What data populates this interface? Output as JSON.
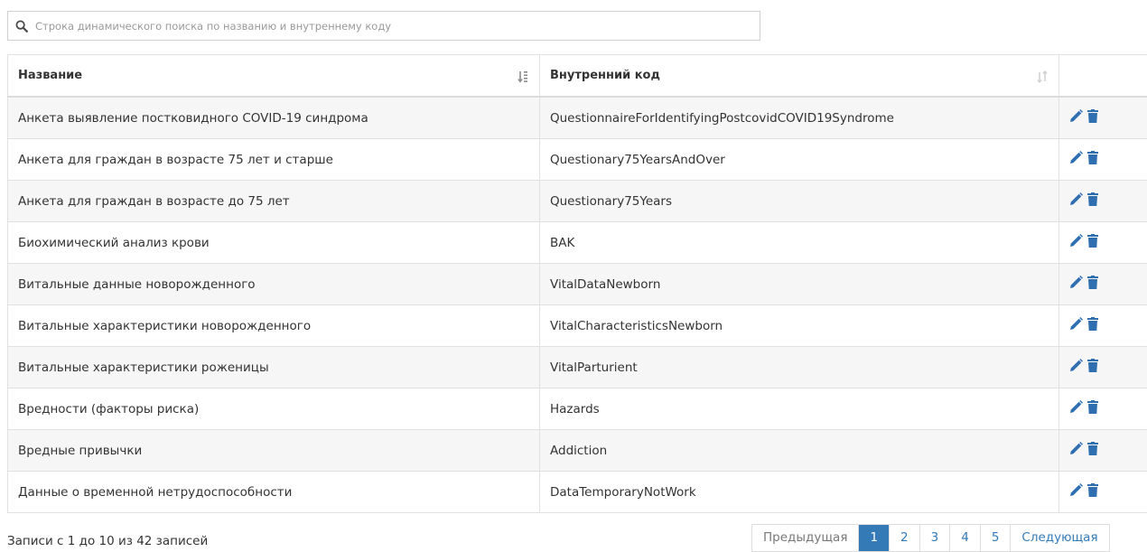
{
  "search": {
    "placeholder": "Строка динамического поиска по названию и внутреннему коду"
  },
  "table": {
    "columns": [
      "Название",
      "Внутренний код"
    ],
    "rows": [
      {
        "name": "Анкета выявление постковидного COVID-19 синдрома",
        "code": "QuestionnaireForIdentifyingPostcovidCOVID19Syndrome"
      },
      {
        "name": "Анкета для граждан в возрасте 75 лет и старше",
        "code": "Questionary75YearsAndOver"
      },
      {
        "name": "Анкета для граждан в возрасте до 75 лет",
        "code": "Questionary75Years"
      },
      {
        "name": "Биохимический анализ крови",
        "code": "BAK"
      },
      {
        "name": "Витальные данные новорожденного",
        "code": "VitalDataNewborn"
      },
      {
        "name": "Витальные характеристики новорожденного",
        "code": "VitalCharacteristicsNewborn"
      },
      {
        "name": "Витальные характеристики роженицы",
        "code": "VitalParturient"
      },
      {
        "name": "Вредности (факторы риска)",
        "code": "Hazards"
      },
      {
        "name": "Вредные привычки",
        "code": "Addiction"
      },
      {
        "name": "Данные о временной нетрудоспособности",
        "code": "DataTemporaryNotWork"
      }
    ]
  },
  "footer": {
    "info": "Записи с 1 до 10 из 42 записей"
  },
  "pagination": {
    "prev": "Предыдущая",
    "pages": [
      "1",
      "2",
      "3",
      "4",
      "5"
    ],
    "active_page": "1",
    "next": "Следующая"
  },
  "icons": {
    "search": "search-icon",
    "sort_active": "sort-alpha-icon",
    "sort": "sort-icon",
    "edit": "pencil-icon",
    "delete": "trash-icon"
  },
  "colors": {
    "accent": "#337ab7",
    "action_icon": "#2f6fb0",
    "row_alt": "#f6f6f6"
  }
}
